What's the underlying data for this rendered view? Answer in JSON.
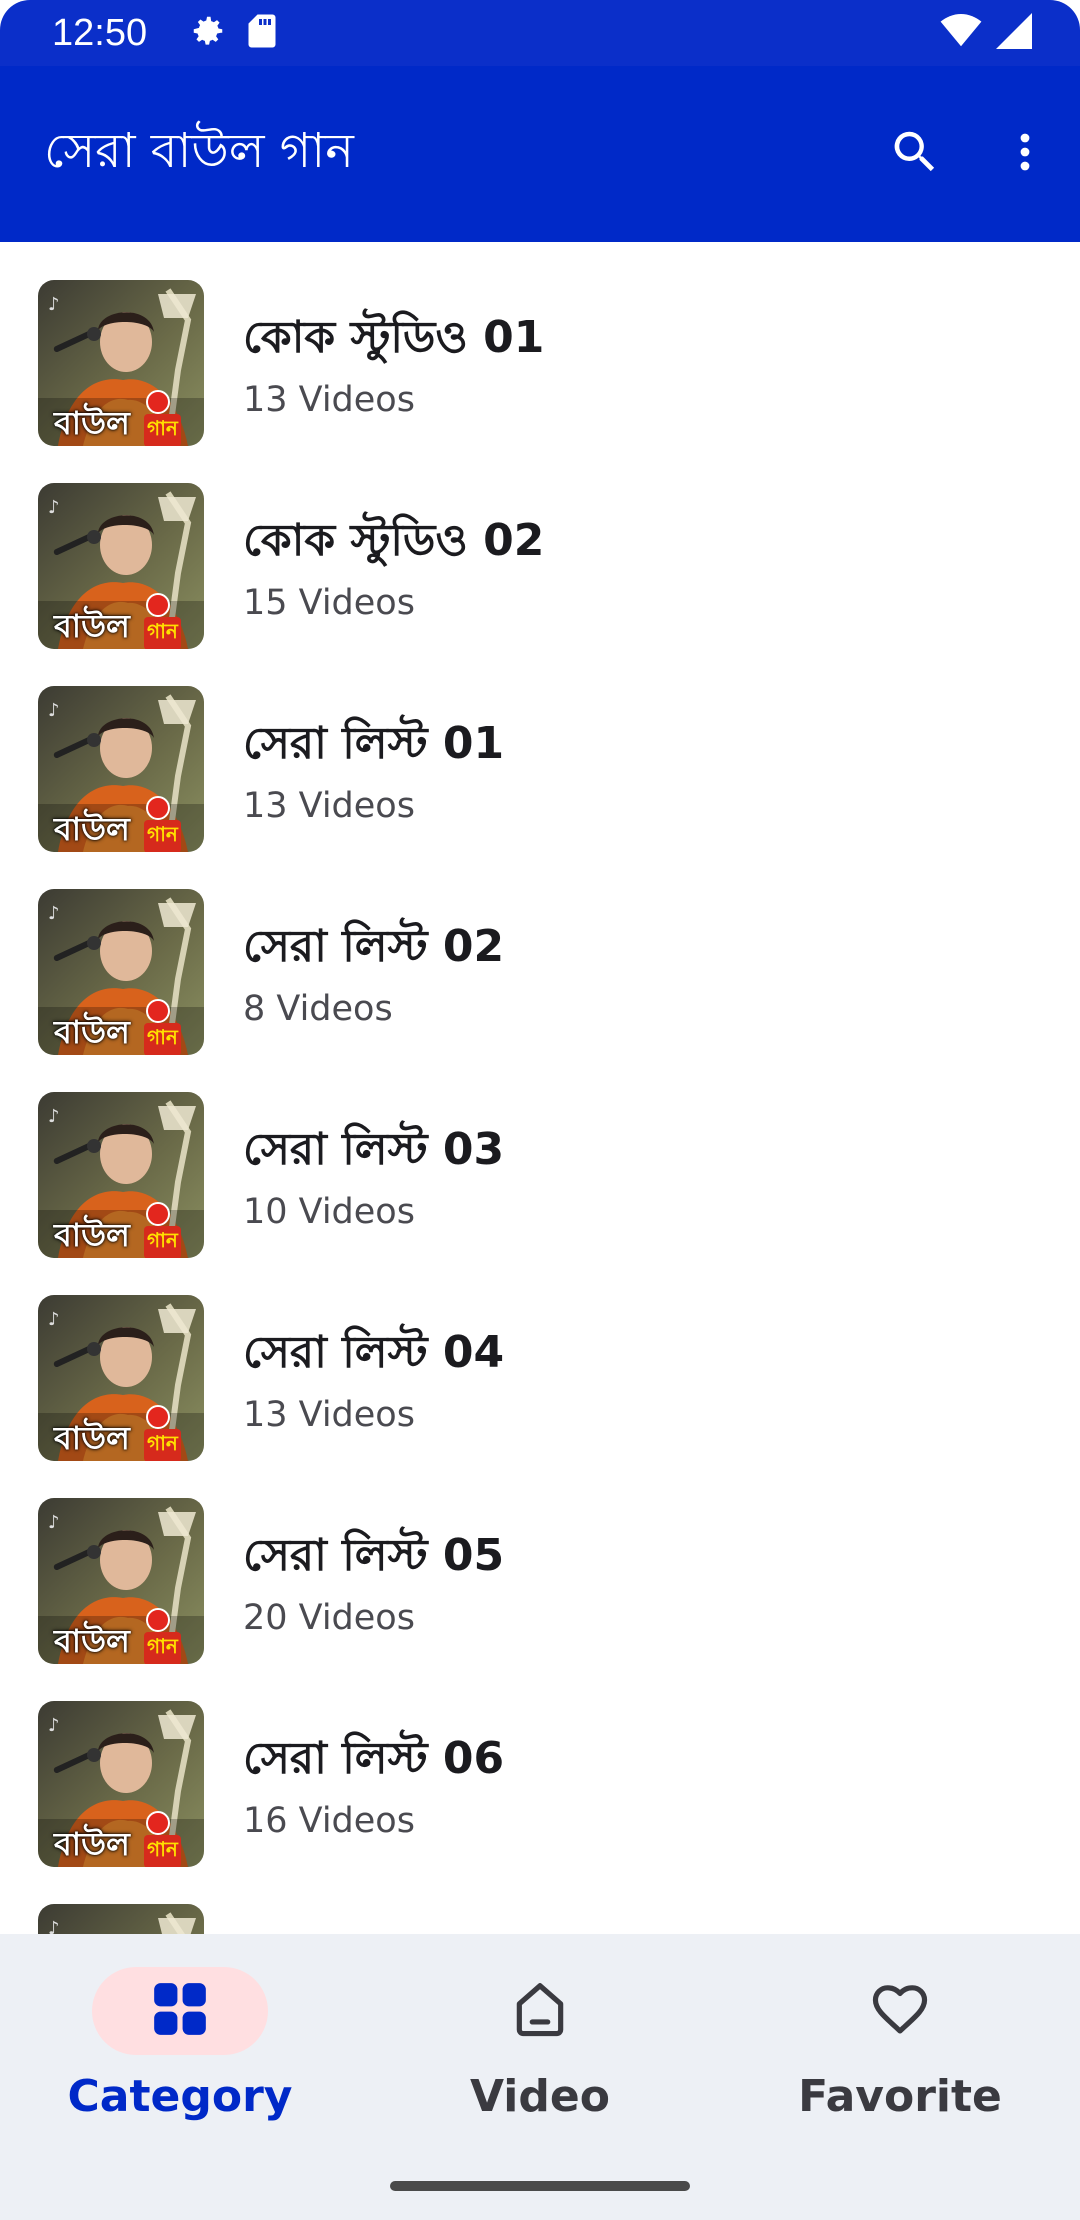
{
  "status_bar": {
    "time": "12:50",
    "icons": [
      "gear-icon",
      "sd-card-icon",
      "wifi-icon",
      "signal-icon"
    ]
  },
  "app_bar": {
    "title": "সেরা বাউল গান",
    "actions": [
      "search-icon",
      "more-vert-icon"
    ]
  },
  "thumbnail": {
    "label_main": "বাউল",
    "label_badge": "গান"
  },
  "playlists": [
    {
      "title": "কোক স্টুডিও 01",
      "subtitle": "13 Videos"
    },
    {
      "title": "কোক স্টুডিও 02",
      "subtitle": "15 Videos"
    },
    {
      "title": "সেরা লিস্ট 01",
      "subtitle": "13 Videos"
    },
    {
      "title": "সেরা লিস্ট 02",
      "subtitle": "8 Videos"
    },
    {
      "title": "সেরা লিস্ট 03",
      "subtitle": "10 Videos"
    },
    {
      "title": "সেরা লিস্ট 04",
      "subtitle": "13 Videos"
    },
    {
      "title": "সেরা লিস্ট 05",
      "subtitle": "20 Videos"
    },
    {
      "title": "সেরা লিস্ট 06",
      "subtitle": "16 Videos"
    },
    {
      "title": "",
      "subtitle": ""
    }
  ],
  "bottom_nav": {
    "items": [
      {
        "label": "Category",
        "icon": "grid-icon",
        "active": true
      },
      {
        "label": "Video",
        "icon": "home-icon",
        "active": false
      },
      {
        "label": "Favorite",
        "icon": "heart-icon",
        "active": false
      }
    ]
  },
  "colors": {
    "primary": "#0029c8",
    "status_bar": "#0b2fc9",
    "nav_background": "#edf0f5",
    "active_pill": "#ffdfe1"
  }
}
